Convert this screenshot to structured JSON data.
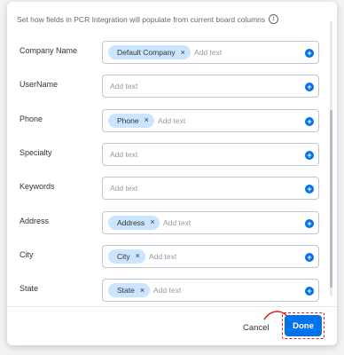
{
  "header": {
    "text": "Set how fields in PCR Integration will populate from current board columns",
    "info_icon": "info-icon"
  },
  "fields": [
    {
      "label": "Company Name",
      "chip": "Default Company",
      "placeholder": "Add text"
    },
    {
      "label": "UserName",
      "chip": null,
      "placeholder": "Add text"
    },
    {
      "label": "Phone",
      "chip": "Phone",
      "placeholder": "Add text"
    },
    {
      "label": "Specialty",
      "chip": null,
      "placeholder": "Add text"
    },
    {
      "label": "Keywords",
      "chip": null,
      "placeholder": "Add text"
    },
    {
      "label": "Address",
      "chip": "Address",
      "placeholder": "Add text"
    },
    {
      "label": "City",
      "chip": "City",
      "placeholder": "Add text"
    },
    {
      "label": "State",
      "chip": "State",
      "placeholder": "Add text"
    }
  ],
  "footer": {
    "cancel_label": "Cancel",
    "done_label": "Done"
  },
  "colors": {
    "primary": "#0073ea",
    "chip_bg": "#cce5ff",
    "annotation": "#e01e1e"
  }
}
